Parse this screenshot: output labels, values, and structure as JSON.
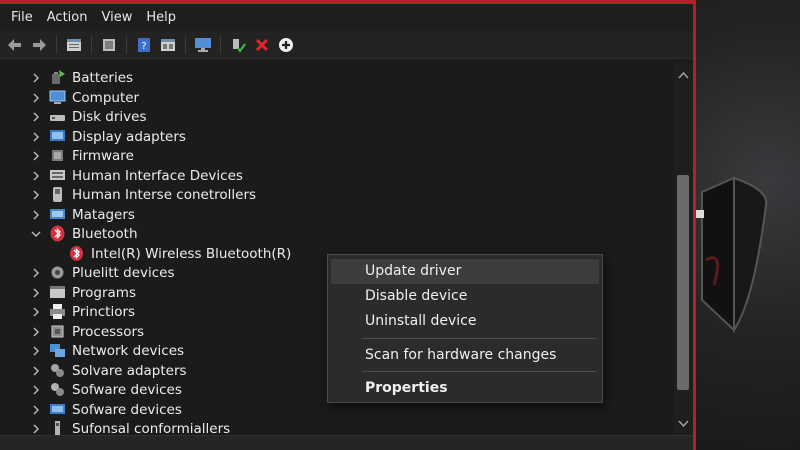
{
  "menu": [
    "File",
    "Action",
    "View",
    "Help"
  ],
  "toolbar": {
    "icons": [
      "back-arrow-icon",
      "forward-arrow-icon",
      "properties-icon",
      "update-icon",
      "help-icon",
      "view-icon",
      "monitor-icon",
      "enable-device-icon",
      "uninstall-x-icon",
      "add-hardware-icon"
    ]
  },
  "tree": {
    "items": [
      {
        "label": "Batteries",
        "icon": "battery-icon",
        "expanded": false
      },
      {
        "label": "Computer",
        "icon": "computer-icon",
        "expanded": false
      },
      {
        "label": "Disk drives",
        "icon": "disk-drive-icon",
        "expanded": false
      },
      {
        "label": "Display adapters",
        "icon": "display-adapter-icon",
        "expanded": false
      },
      {
        "label": "Firmware",
        "icon": "firmware-icon",
        "expanded": false
      },
      {
        "label": "Human Interface Devices",
        "icon": "hid-icon",
        "expanded": false
      },
      {
        "label": "Human Interse conetrollers",
        "icon": "controller-icon",
        "expanded": false
      },
      {
        "label": "Matagers",
        "icon": "monitor-icon",
        "expanded": false
      },
      {
        "label": "Bluetooth",
        "icon": "bluetooth-icon",
        "expanded": true
      },
      {
        "label": "Intel(R) Wireless Bluetooth(R)",
        "icon": "bluetooth-icon",
        "child": true
      },
      {
        "label": "Pluelitt devices",
        "icon": "gear-device-icon",
        "expanded": false
      },
      {
        "label": "Programs",
        "icon": "program-icon",
        "expanded": false
      },
      {
        "label": "Princtiors",
        "icon": "printer-icon",
        "expanded": false
      },
      {
        "label": "Processors",
        "icon": "processor-icon",
        "expanded": false
      },
      {
        "label": "Network devices",
        "icon": "network-icon",
        "expanded": false
      },
      {
        "label": "Solvare adapters",
        "icon": "software-adapter-icon",
        "expanded": false
      },
      {
        "label": "Sofware devices",
        "icon": "software-device-icon",
        "expanded": false
      },
      {
        "label": "Sofware devices",
        "icon": "software-device-icon",
        "expanded": false
      },
      {
        "label": "Sufonsal conformiallers",
        "icon": "usb-controller-icon",
        "expanded": false
      }
    ]
  },
  "context_menu": {
    "update_driver": "Update driver",
    "disable_device": "Disable device",
    "uninstall_device": "Uninstall device",
    "scan_hardware": "Scan for hardware changes",
    "properties": "Properties"
  },
  "colors": {
    "accent_border": "#b3202a",
    "background": "#1b1b1b",
    "bluetooth_red": "#d4313f",
    "menu_highlight": "#3d3d3d"
  }
}
